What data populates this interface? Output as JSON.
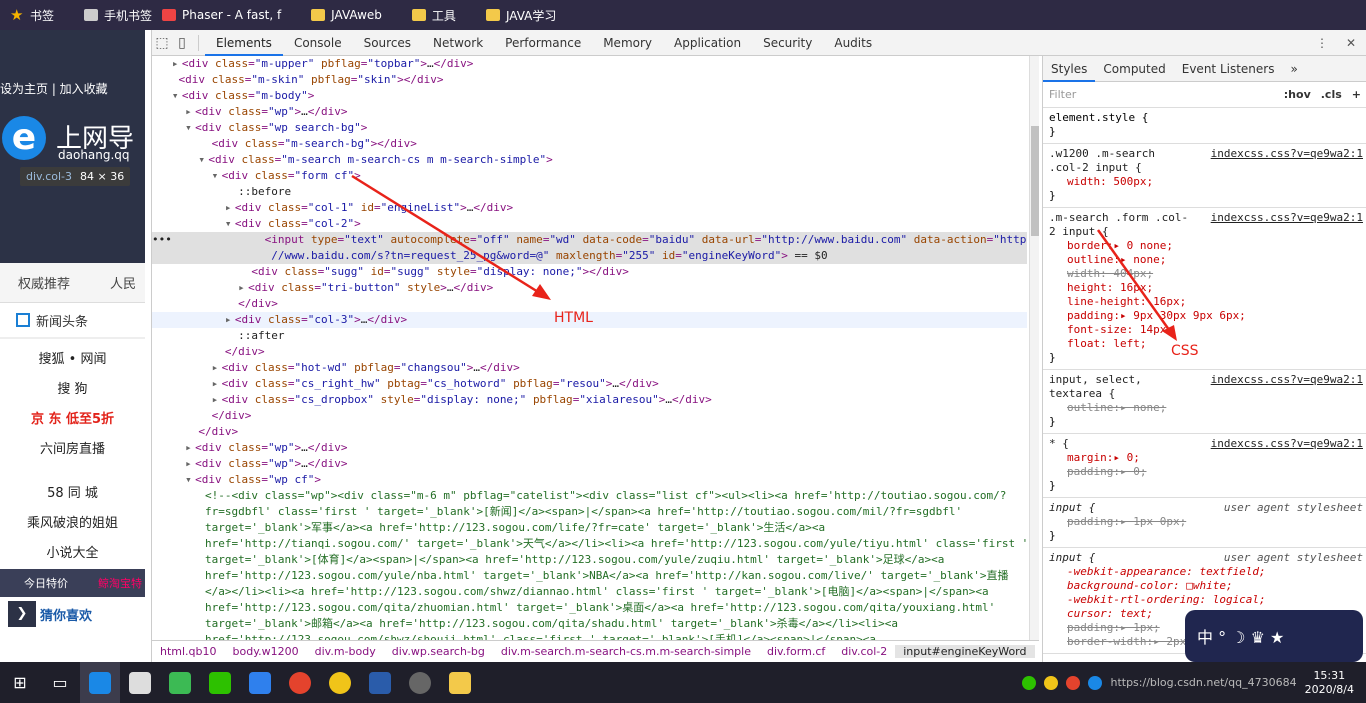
{
  "bookmarks": [
    {
      "icon": "star-icon",
      "label": "书签"
    },
    {
      "icon": "page-icon",
      "label": "手机书签"
    },
    {
      "icon": "phaser-icon",
      "label": "Phaser - A fast, f"
    },
    {
      "icon": "folder-icon",
      "label": "JAVAweb"
    },
    {
      "icon": "folder-icon",
      "label": "工具"
    },
    {
      "icon": "folder-icon",
      "label": "JAVA学习"
    }
  ],
  "page": {
    "links": "设为主页 | 加入收藏",
    "logo_char": "e",
    "title": "上网导",
    "subtitle": "daohang.qq",
    "tooltip_cls": "div.col-3",
    "tooltip_size": "84 × 36",
    "tabs": [
      "权威推荐",
      "人民"
    ],
    "news": "新闻头条",
    "list": [
      "搜狐 • 网闻",
      "搜 狗",
      "京 东 低至5折",
      "六间房直播",
      "58 同 城",
      "乘风破浪的姐姐",
      "小说大全"
    ],
    "banner": [
      "今日特价",
      "鲸淘宝特"
    ],
    "guess": "猜你喜欢"
  },
  "devtools": {
    "tabs": [
      "Elements",
      "Console",
      "Sources",
      "Network",
      "Performance",
      "Memory",
      "Application",
      "Security",
      "Audits"
    ],
    "active_tab": "Elements"
  },
  "breadcrumbs": [
    "html.qb10",
    "body.w1200",
    "div.m-body",
    "div.wp.search-bg",
    "div.m-search.m-search-cs.m.m-search-simple",
    "div.form.cf",
    "div.col-2",
    "input#engineKeyWord"
  ],
  "styles": {
    "tabs": [
      "Styles",
      "Computed",
      "Event Listeners",
      "»"
    ],
    "filter": "Filter",
    "hov": ":hov",
    "cls": ".cls",
    "plus": "+",
    "element_style": "element.style {",
    "close": "}",
    "r1": {
      "sel": ".w1200 .m-search .col-2 input {",
      "src": "indexcss.css?v=qe9wa2:1",
      "props": [
        "width: 500px;"
      ]
    },
    "r2": {
      "sel1": ".m-search .form .col-",
      "sel2": "2 input {",
      "src": "indexcss.css?v=qe9wa2:1",
      "props": [
        "border:▸ 0 none;",
        "outline:▸ none;",
        "width: 404px;",
        "height: 16px;",
        "line-height: 16px;",
        "padding:▸ 9px 30px 9px 6px;",
        "font-size: 14px;",
        "float: left;"
      ]
    },
    "r3": {
      "sel1": "input, select,",
      "sel2": "textarea {",
      "src": "indexcss.css?v=qe9wa2:1",
      "props": [
        "outline:▸ none;"
      ]
    },
    "r4": {
      "sel": "* {",
      "src": "indexcss.css?v=qe9wa2:1",
      "props": [
        "margin:▸ 0;",
        "padding:▸ 0;"
      ]
    },
    "r5": {
      "sel": "input {",
      "src": "user agent stylesheet",
      "props": [
        "padding:▸ 1px 0px;"
      ]
    },
    "r6": {
      "sel": "input {",
      "src": "user agent stylesheet",
      "props": [
        "-webkit-appearance: textfield;",
        "background-color: □white;",
        "-webkit-rtl-ordering: logical;",
        "cursor: text;",
        "padding:▸ 1px;",
        "border-width:▸ 2px;"
      ]
    }
  },
  "annotations": {
    "html": "HTML",
    "css": "CSS"
  },
  "taskbar": {
    "time": "15:31",
    "date": "2020/8/4",
    "watermark": "https://blog.csdn.net/qq_4730684"
  },
  "colors": {
    "accent": "#1a73e8",
    "annotation": "#e8231a",
    "tag": "#881280",
    "attr": "#994500",
    "value": "#1a1aa6"
  }
}
